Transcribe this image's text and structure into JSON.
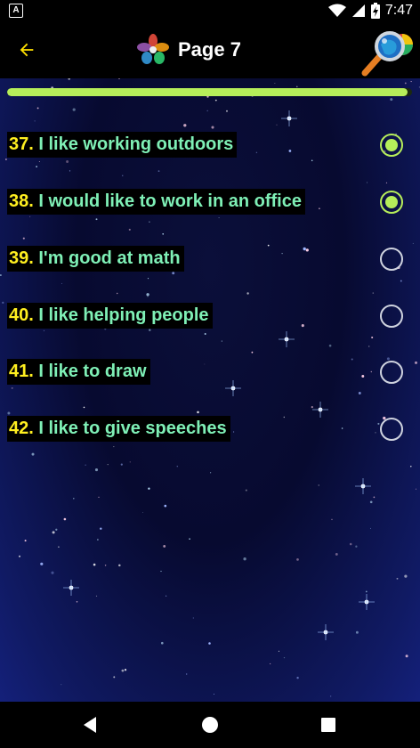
{
  "status_bar": {
    "notification_icon_letter": "A",
    "time": "7:47"
  },
  "app_bar": {
    "title": "Page 7"
  },
  "progress": {
    "fraction": 0.99
  },
  "questions": [
    {
      "number": "37.",
      "text": "I like working outdoors",
      "selected": true
    },
    {
      "number": "38.",
      "text": "I would like to work in an office",
      "selected": true
    },
    {
      "number": "39.",
      "text": "I'm good at math",
      "selected": false
    },
    {
      "number": "40.",
      "text": "I like helping people",
      "selected": false
    },
    {
      "number": "41.",
      "text": "I like to draw",
      "selected": false
    },
    {
      "number": "42.",
      "text": "I like to give speeches",
      "selected": false
    }
  ],
  "colors": {
    "accent_green": "#b6ee5a",
    "number_yellow": "#ffef20",
    "text_mint": "#7ff0b6"
  }
}
